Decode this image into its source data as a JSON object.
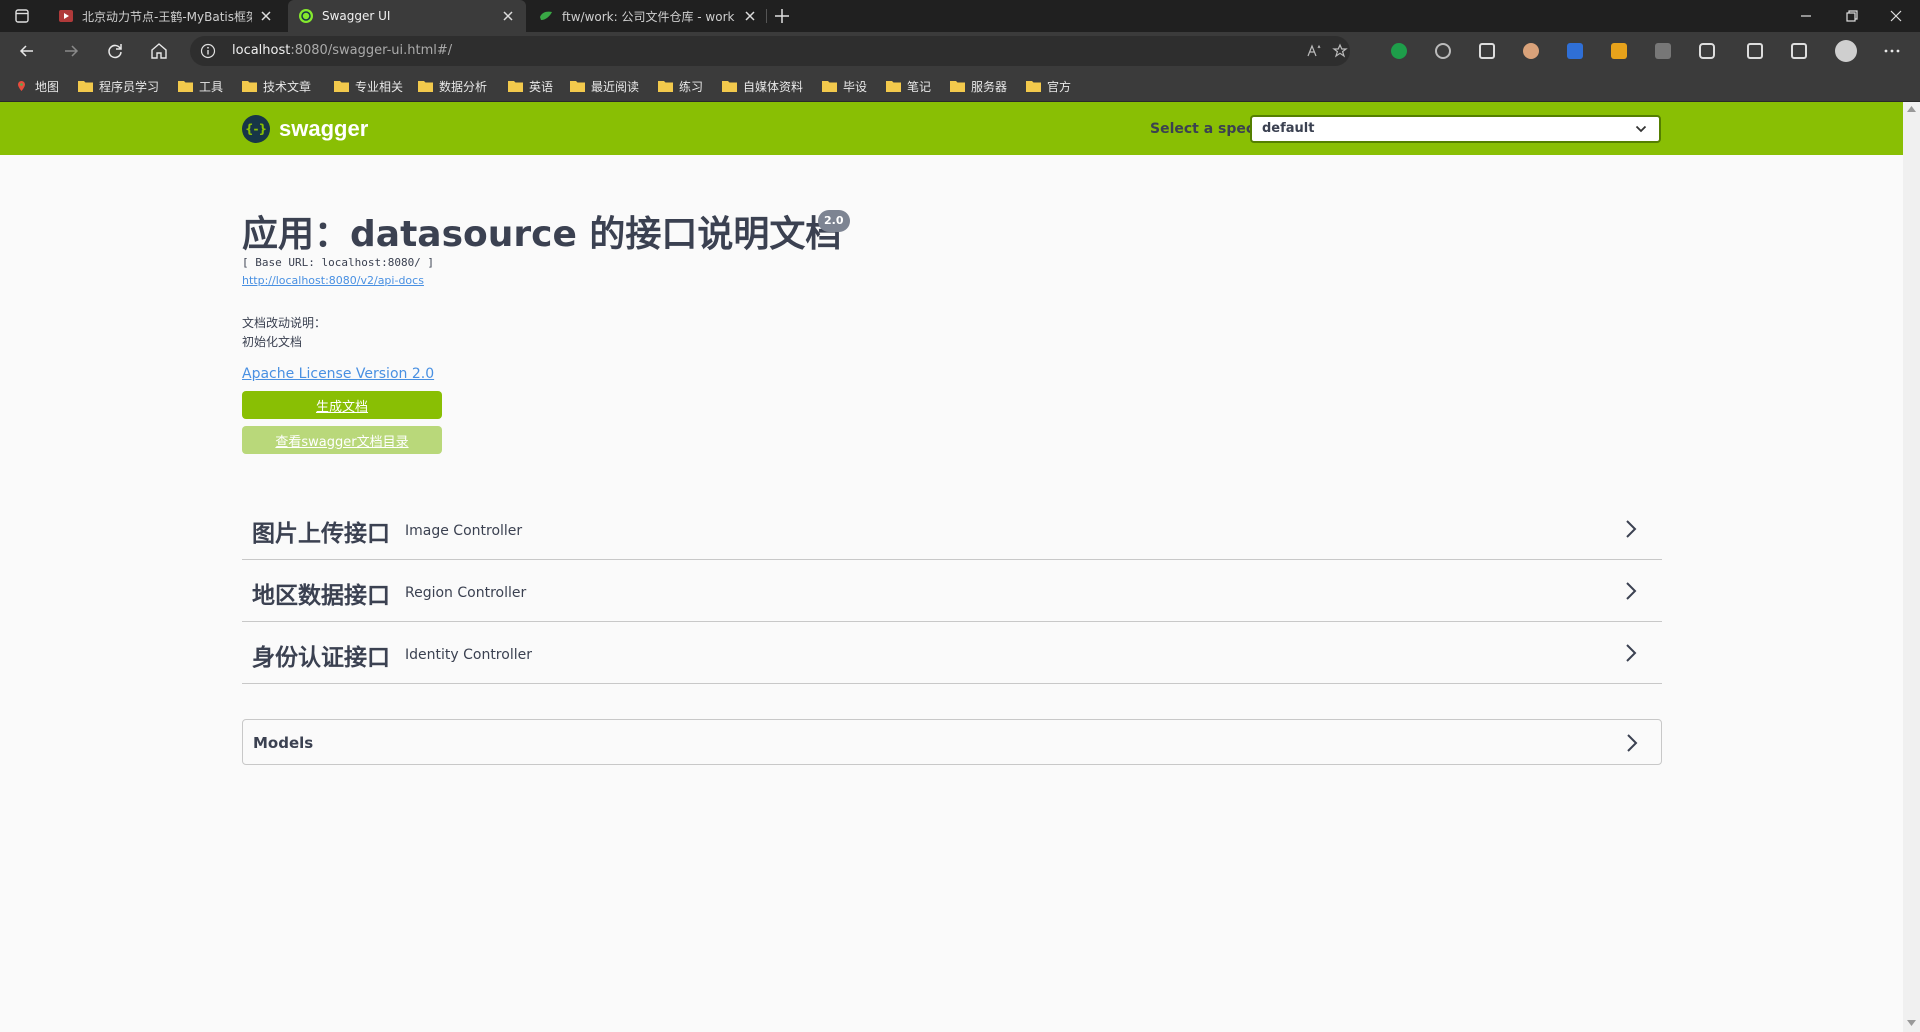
{
  "tabs": [
    {
      "title": "北京动力节点-王鹤-MyBatis框架",
      "favicon": "video-favicon-icon"
    },
    {
      "title": "Swagger UI",
      "favicon": "swagger-favicon-icon"
    },
    {
      "title": "ftw/work: 公司文件仓库 - work -",
      "favicon": "gitee-favicon-icon"
    }
  ],
  "address_bar": {
    "host": "localhost",
    "rest": ":8080/swagger-ui.html#/"
  },
  "bookmarks": [
    "地图",
    "程序员学习",
    "工具",
    "技术文章",
    "专业相关",
    "数据分析",
    "英语",
    "最近阅读",
    "练习",
    "自媒体资料",
    "毕设",
    "笔记",
    "服务器",
    "官方"
  ],
  "swagger": {
    "logo_text": "swagger",
    "logo_mark": "{-}",
    "spec_label": "Select a spec",
    "spec_selected": "default"
  },
  "info": {
    "title": "应用：datasource 的接口说明文档",
    "version": "2.0",
    "base_url": "[ Base URL: localhost:8080/ ]",
    "api_docs_link": "http://localhost:8080/v2/api-docs",
    "desc_line1": "文档改动说明：",
    "desc_line2": "初始化文档",
    "license": "Apache License Version 2.0",
    "generate_button": "生成文档",
    "view_docs_button": "查看swagger文档目录"
  },
  "controllers": [
    {
      "name": "图片上传接口",
      "desc": "Image Controller"
    },
    {
      "name": "地区数据接口",
      "desc": "Region Controller"
    },
    {
      "name": "身份认证接口",
      "desc": "Identity Controller"
    }
  ],
  "models_title": "Models",
  "colors": {
    "swagger_green": "#89bf04",
    "text": "#3b4151",
    "link": "#4990e2",
    "chrome_dark": "#202020",
    "chrome_toolbar": "#3b3b3b"
  }
}
